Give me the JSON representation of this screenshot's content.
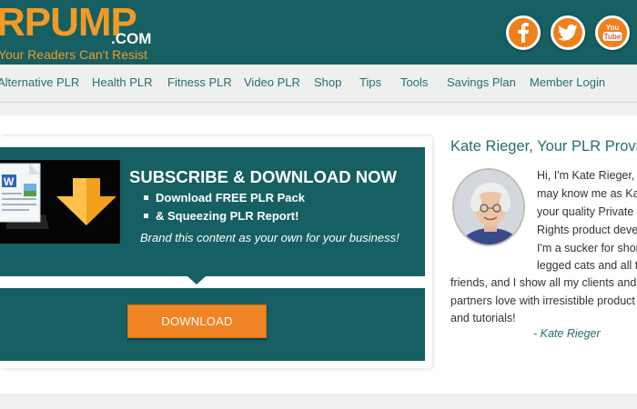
{
  "brand": {
    "logo_main": "RPUMP",
    "logo_com": ".COM",
    "tagline": "Your Readers Can't Resist"
  },
  "social": [
    {
      "name": "facebook",
      "label": "f"
    },
    {
      "name": "twitter",
      "label": ""
    },
    {
      "name": "youtube",
      "label": "You Tube"
    }
  ],
  "nav": {
    "items": [
      {
        "label": "Alternative PLR"
      },
      {
        "label": "Health PLR"
      },
      {
        "label": "Fitness PLR"
      },
      {
        "label": "Video PLR"
      },
      {
        "label": "Shop"
      },
      {
        "label": "Tips"
      },
      {
        "label": "Tools"
      },
      {
        "label": "Savings Plan"
      },
      {
        "label": "Member Login"
      }
    ]
  },
  "subscribe": {
    "title": "SUBSCRIBE & DOWNLOAD NOW",
    "bullets": [
      "Download FREE PLR Pack",
      "& Squeezing PLR Report!"
    ],
    "note": "Brand this content as your own for your business!",
    "button_label": "Download"
  },
  "sidebar": {
    "title": "Kate Rieger, Your PLR Provi",
    "bio_lines": [
      "Hi, I'm Kate Rieger, o",
      "may know me as Ka",
      "your quality Private",
      "Rights product deve",
      "I'm a sucker for shor",
      "legged cats and all t",
      "friends, and I show all my clients and",
      "partners love with irresistible product",
      "and tutorials!"
    ],
    "signature": "- Kate Rieger"
  },
  "colors": {
    "header_teal": "#165f62",
    "accent_orange": "#f39a26",
    "button_orange": "#f08424",
    "link_teal": "#2b6b73"
  }
}
